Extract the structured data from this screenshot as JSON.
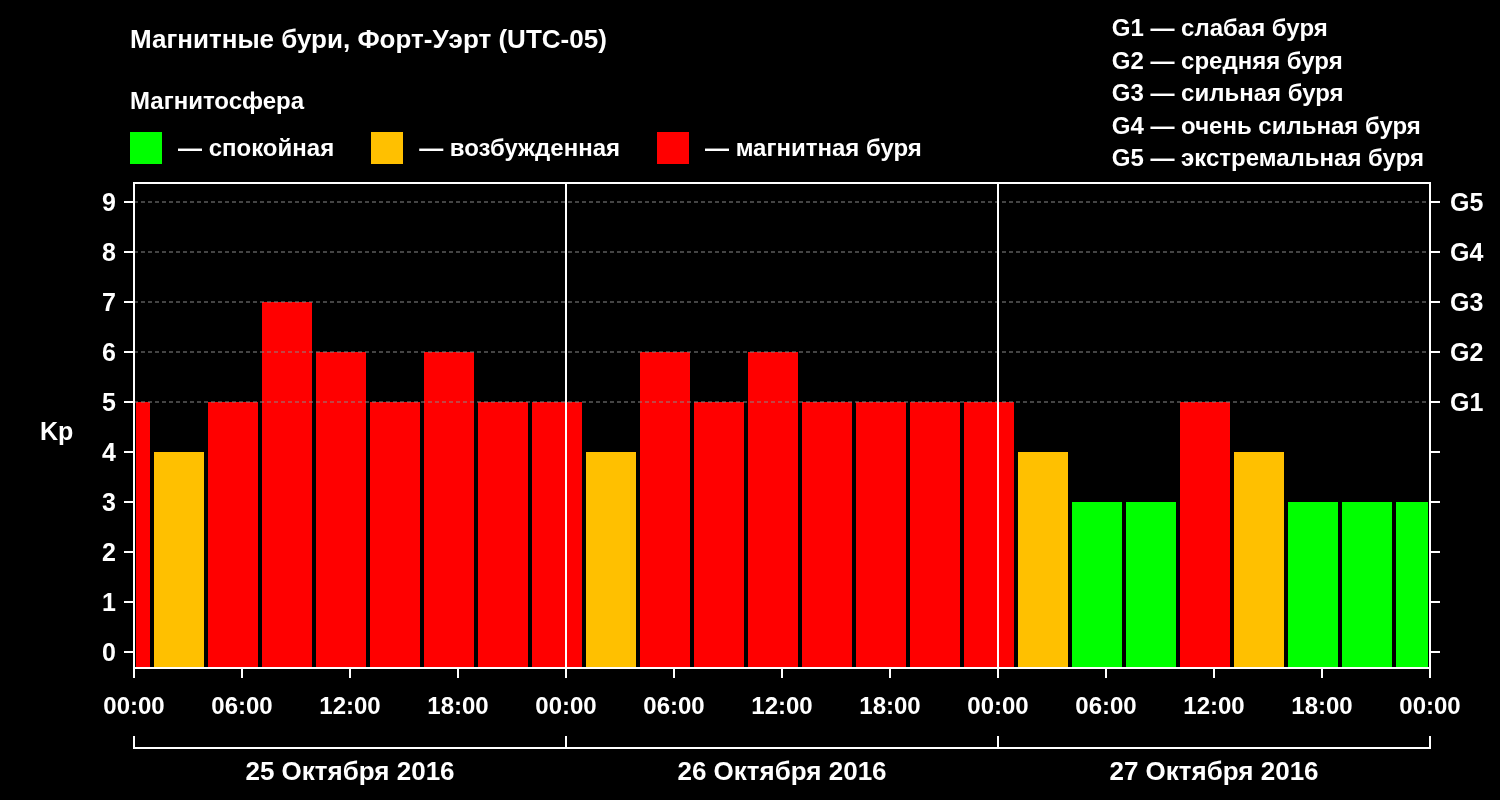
{
  "title": "Магнитные бури, Форт-Уэрт (UTC-05)",
  "legend": {
    "heading": "Магнитосфера"
  },
  "storm_levels": [
    "G1 — слабая буря",
    "G2 — средняя буря",
    "G3 — сильная буря",
    "G4 — очень сильная буря",
    "G5 — экстремальная буря"
  ],
  "chart": {
    "chart_data": {
      "type": "bar",
      "ylabel": "Kp",
      "grid": true,
      "x": [
        0.5,
        2.5,
        5.5,
        8.5,
        11.5,
        14.5,
        17.5,
        20.5,
        23.5,
        26.5,
        29.5,
        32.5,
        35.5,
        38.5,
        41.5,
        44.5,
        47.5,
        50.5,
        53.5,
        56.5,
        59.5,
        62.5,
        65.5,
        68.5,
        71
      ],
      "series": [
        {
          "name": "— спокойная",
          "color": "#00ff00",
          "values": [
            null,
            null,
            null,
            null,
            null,
            null,
            null,
            null,
            null,
            null,
            null,
            null,
            null,
            null,
            null,
            null,
            null,
            null,
            3,
            3,
            null,
            null,
            3,
            3,
            3
          ]
        },
        {
          "name": "— возбужденная",
          "color": "#ffc000",
          "values": [
            null,
            4,
            null,
            null,
            null,
            null,
            null,
            null,
            null,
            4,
            null,
            null,
            null,
            null,
            null,
            null,
            null,
            4,
            null,
            null,
            null,
            4,
            null,
            null,
            null
          ]
        },
        {
          "name": "— магнитная буря",
          "color": "#ff0000",
          "values": [
            5,
            null,
            5,
            7,
            6,
            5,
            6,
            5,
            5,
            null,
            6,
            5,
            6,
            5,
            5,
            5,
            5,
            null,
            null,
            null,
            5,
            null,
            null,
            null,
            null
          ]
        }
      ],
      "ref_lines": [
        {
          "axis": "x",
          "value": 24
        },
        {
          "axis": "x",
          "value": 48
        }
      ],
      "xlim": [
        0,
        72
      ],
      "ylim": [
        0,
        9
      ],
      "yticks": [
        0,
        1,
        2,
        3,
        4,
        5,
        6,
        7,
        8,
        9
      ],
      "xticks": [
        {
          "value": 0,
          "label": "00:00"
        },
        {
          "value": 6,
          "label": "06:00"
        },
        {
          "value": 12,
          "label": "12:00"
        },
        {
          "value": 18,
          "label": "18:00"
        }
      ]
    },
    "later_time_labels": [
      "00:00",
      "06:00",
      "12:00",
      "18:00",
      "00:00",
      "06:00",
      "12:00",
      "18:00",
      "00:00"
    ],
    "g_scale": [
      {
        "label": "G5"
      },
      {
        "label": "G4"
      },
      {
        "label": "G3"
      },
      {
        "label": "G2"
      },
      {
        "label": "G1"
      }
    ],
    "days": [
      "25 Октября 2016",
      "26 Октября 2016",
      "27 Октября 2016"
    ]
  }
}
